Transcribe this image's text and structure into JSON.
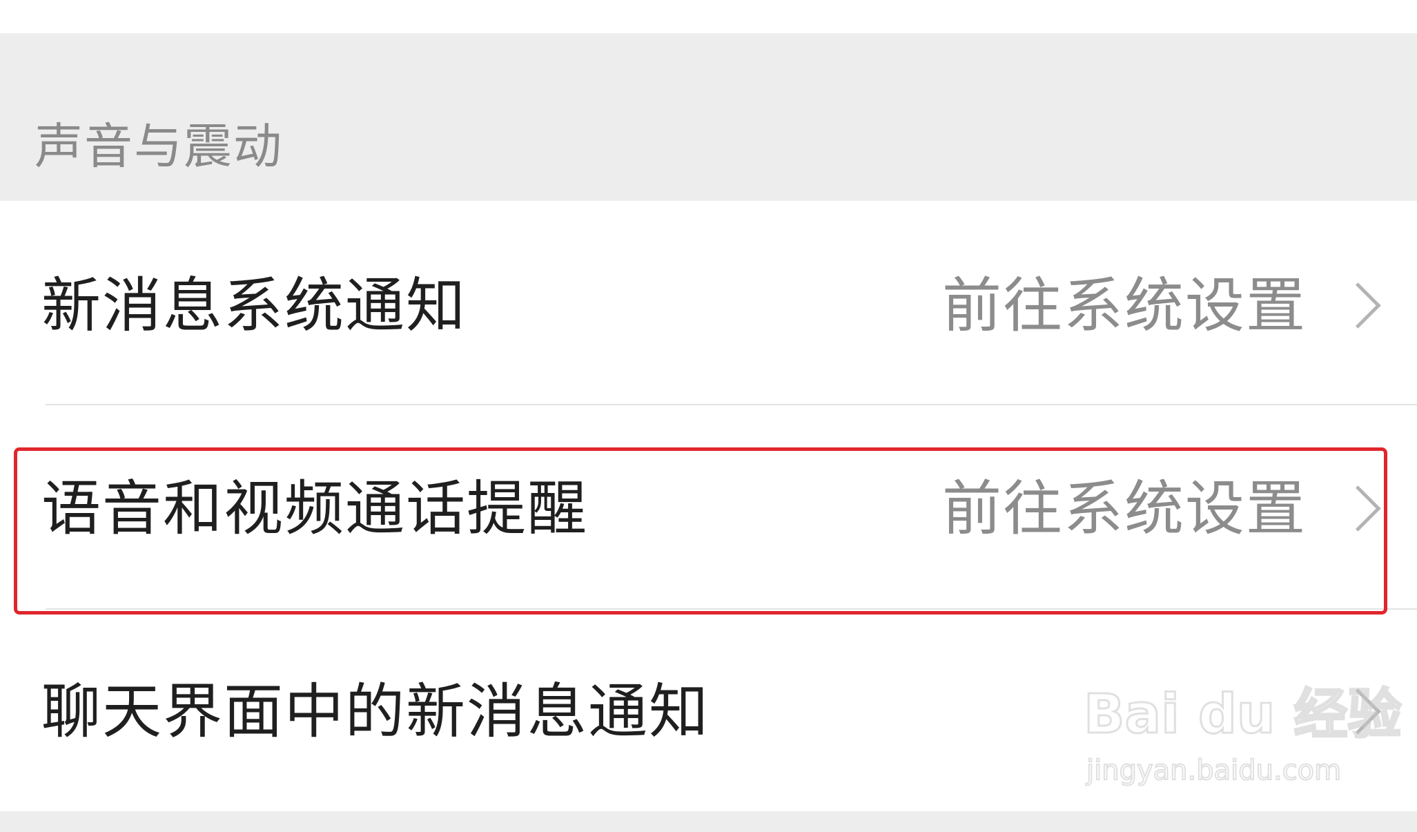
{
  "section": {
    "title": "声音与震动"
  },
  "rows": [
    {
      "label": "新消息系统通知",
      "value": "前往系统设置"
    },
    {
      "label": "语音和视频通话提醒",
      "value": "前往系统设置"
    },
    {
      "label": "聊天界面中的新消息通知",
      "value": ""
    }
  ],
  "watermark": {
    "logo": "Bai du 经验",
    "url": "jingyan.baidu.com"
  },
  "colors": {
    "section_bg": "#ededed",
    "highlight": "#e0262b",
    "primary_text": "#1f1f1f",
    "secondary_text": "#8c8c8c"
  }
}
